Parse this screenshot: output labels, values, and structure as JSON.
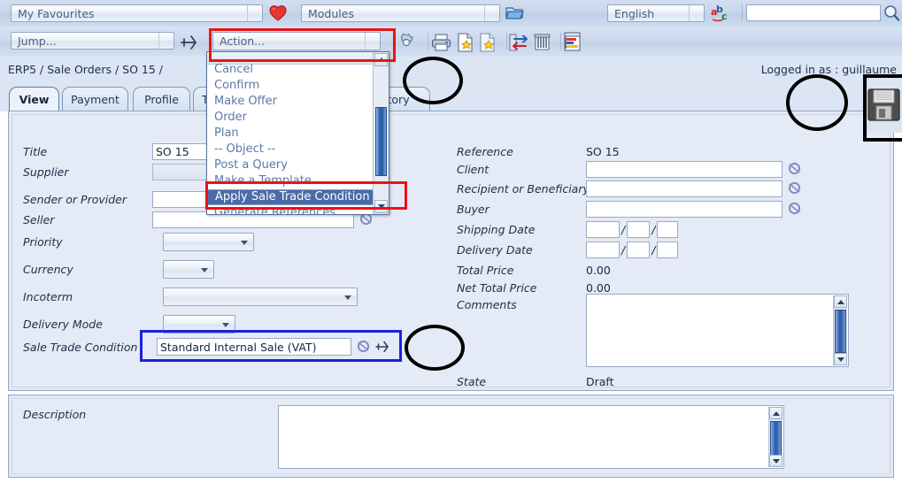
{
  "header": {
    "favourites_label": "My Favourites",
    "favourites_icon": "heart-icon",
    "modules_label": "Modules",
    "modules_icon": "open-folder-icon",
    "language_label": "English",
    "language_icon": "abc-translate-icon",
    "search_value": "",
    "search_icon": "magnifier-icon"
  },
  "toolbar": {
    "jump_label": "Jump...",
    "jump_icon": "plane-jump-icon",
    "action_label": "Action...",
    "icons": [
      "gear-icon",
      "print-icon",
      "new-document-icon",
      "copy-document-icon",
      "exchange-arrows-icon",
      "delete-icon",
      "report-chart-icon"
    ]
  },
  "action_menu": {
    "options": [
      "Cancel",
      "Confirm",
      "Make Offer",
      "Order",
      "Plan",
      "-- Object --",
      "Post a Query",
      "Make a Template",
      "Apply Sale Trade Condition",
      "Generate References"
    ],
    "selected": "Apply Sale Trade Condition"
  },
  "breadcrumb": "ERP5 / Sale Orders / SO 15 /",
  "logged_in": "Logged in as : guillaume",
  "save_icon": "floppy-save-icon",
  "tabs": [
    {
      "label": "View",
      "active": true
    },
    {
      "label": "Payment",
      "active": false
    },
    {
      "label": "Profile",
      "active": false
    },
    {
      "label": "Ta",
      "active": false
    },
    {
      "label": "story",
      "active": false
    }
  ],
  "form": {
    "left": {
      "title_label": "Title",
      "title_value": "SO 15",
      "supplier_label": "Supplier",
      "supplier_value": "",
      "sender_label": "Sender or Provider",
      "sender_value": "",
      "seller_label": "Seller",
      "seller_value": "",
      "priority_label": "Priority",
      "priority_value": "",
      "currency_label": "Currency",
      "currency_value": "",
      "incoterm_label": "Incoterm",
      "incoterm_value": "",
      "delivery_mode_label": "Delivery Mode",
      "delivery_mode_value": "",
      "stc_label": "Sale Trade Condition",
      "stc_value": "Standard Internal Sale (VAT)"
    },
    "right": {
      "reference_label": "Reference",
      "reference_value": "SO 15",
      "client_label": "Client",
      "client_value": "",
      "recipient_label": "Recipient or Beneficiary",
      "recipient_value": "",
      "buyer_label": "Buyer",
      "buyer_value": "",
      "shipping_date_label": "Shipping Date",
      "delivery_date_label": "Delivery Date",
      "date_sep": "/",
      "total_price_label": "Total Price",
      "total_price_value": "0.00",
      "net_total_price_label": "Net Total Price",
      "net_total_price_value": "0.00",
      "comments_label": "Comments",
      "comments_value": "",
      "state_label": "State",
      "state_value": "Draft"
    },
    "description_label": "Description",
    "description_value": ""
  },
  "colors": {
    "annotation_red": "#ee1111",
    "annotation_blue": "#1c20e0",
    "annotation_black": "#000000",
    "menu_highlight": "#4a6ba8",
    "panel_bg": "#e4eaf6",
    "header_bg": "#cbd9ec"
  }
}
